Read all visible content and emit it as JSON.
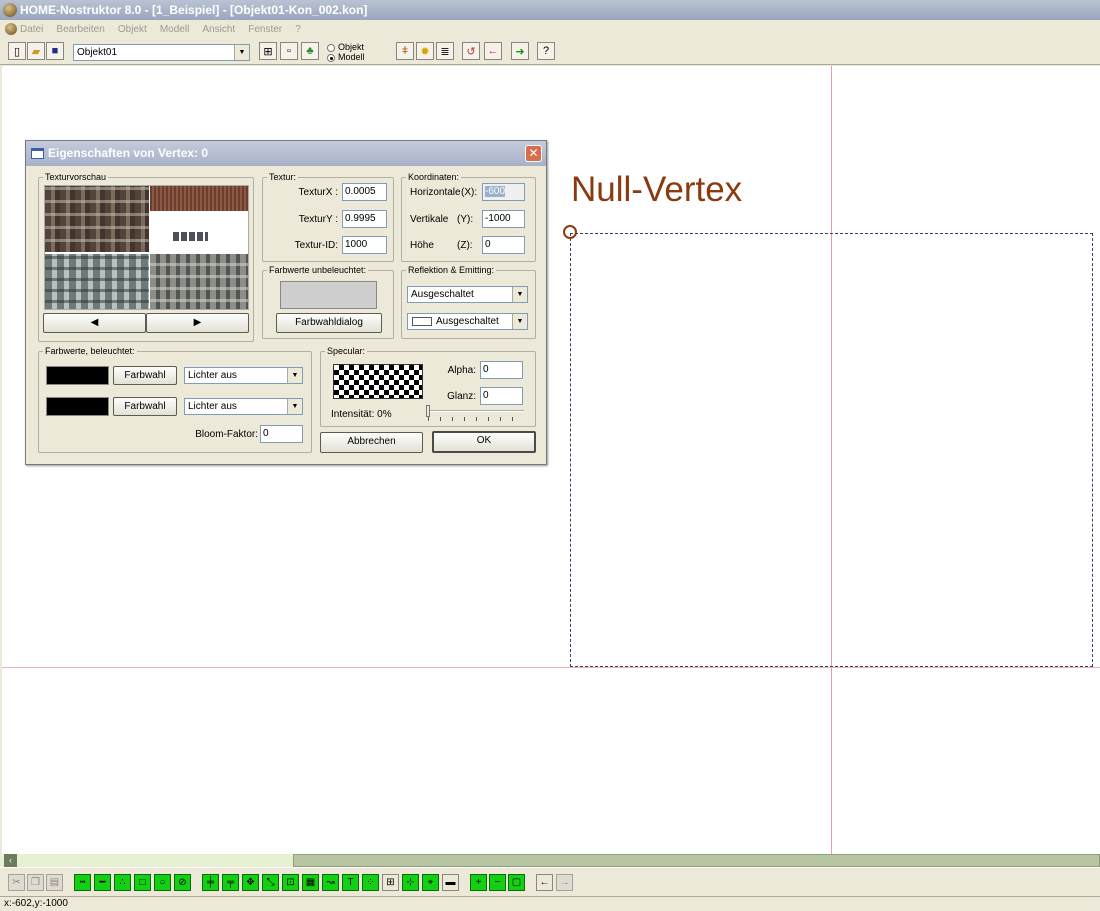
{
  "window": {
    "title": "HOME-Nostruktor 8.0 - [1_Beispiel] - [Objekt01-Kon_002.kon]"
  },
  "menu": [
    "Datei",
    "Bearbeiten",
    "Objekt",
    "Modell",
    "Ansicht",
    "Fenster",
    "?"
  ],
  "toolbar": {
    "object_select": "Objekt01",
    "radio_objekt": "Objekt",
    "radio_modell": "Modell",
    "selected_mode": "Modell"
  },
  "canvas": {
    "label": "Null-Vertex",
    "accent": "#8b3a10"
  },
  "dialog": {
    "title": "Eigenschaften von Vertex: 0",
    "textur_vorschau": {
      "legend": "Texturvorschau"
    },
    "textur": {
      "legend": "Textur:",
      "texturx_label": "TexturX :",
      "texturx_value": "0.0005",
      "texturey_label": "TexturY :",
      "texturey_value": "0.9995",
      "texturid_label": "Textur-ID:",
      "texturid_value": "1000"
    },
    "koordinaten": {
      "legend": "Koordinaten:",
      "horizontale_label": "Horizontale",
      "horizontale_axis": "(X):",
      "horizontale_value": "-600",
      "vertikale_label": "Vertikale",
      "vertikale_axis": "(Y):",
      "vertikale_value": "-1000",
      "hoehe_label": "Höhe",
      "hoehe_axis": "(Z):",
      "hoehe_value": "0"
    },
    "farbwerte_unbeleuchtet": {
      "legend": "Farbwerte unbeleuchtet:",
      "button": "Farbwahldialog"
    },
    "reflektion": {
      "legend": "Reflektion & Emitting:",
      "select1": "Ausgeschaltet",
      "select2": "Ausgeschaltet"
    },
    "farbwerte_beleuchtet": {
      "legend": "Farbwerte, beleuchtet:",
      "farbwahl1": "Farbwahl",
      "farbwahl2": "Farbwahl",
      "lichter1": "Lichter aus",
      "lichter2": "Lichter aus",
      "bloom_label": "Bloom-Faktor:",
      "bloom_value": "0"
    },
    "specular": {
      "legend": "Specular:",
      "alpha_label": "Alpha:",
      "alpha_value": "0",
      "glanz_label": "Glanz:",
      "glanz_value": "0",
      "intensitaet_label": "Intensität: 0%"
    },
    "buttons": {
      "cancel": "Abbrechen",
      "ok": "OK"
    }
  },
  "status": {
    "coords": "x:-602,y:-1000"
  }
}
